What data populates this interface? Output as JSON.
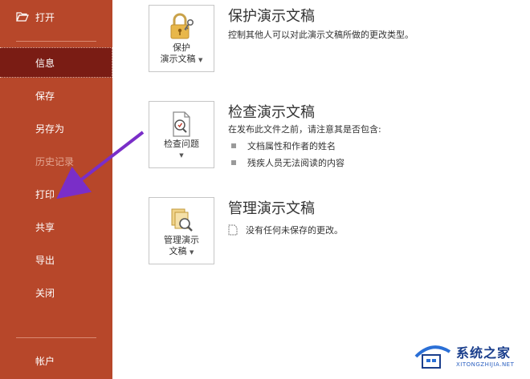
{
  "sidebar": {
    "open": "打开",
    "items": [
      {
        "label": "信息"
      },
      {
        "label": "保存"
      },
      {
        "label": "另存为"
      },
      {
        "label": "历史记录"
      },
      {
        "label": "打印"
      },
      {
        "label": "共享"
      },
      {
        "label": "导出"
      },
      {
        "label": "关闭"
      }
    ],
    "account": "帐户"
  },
  "sections": {
    "protect": {
      "card_line1": "保护",
      "card_line2": "演示文稿",
      "title": "保护演示文稿",
      "desc": "控制其他人可以对此演示文稿所做的更改类型。"
    },
    "inspect": {
      "card_label": "检查问题",
      "title": "检查演示文稿",
      "desc": "在发布此文件之前，请注意其是否包含:",
      "bullets": [
        "文档属性和作者的姓名",
        "残疾人员无法阅读的内容"
      ]
    },
    "manage": {
      "card_line1": "管理演示",
      "card_line2": "文稿",
      "title": "管理演示文稿",
      "note": "没有任何未保存的更改。"
    }
  },
  "watermark": {
    "main": "系统之家",
    "sub": "XITONGZHIJIA.NET"
  },
  "colors": {
    "sidebar_bg": "#b7472a",
    "sidebar_selected": "#7a1c14",
    "arrow": "#7a2ec8"
  }
}
